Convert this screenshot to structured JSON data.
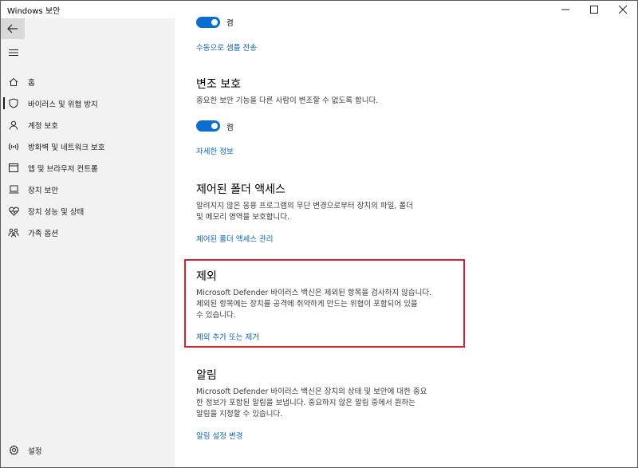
{
  "window": {
    "title": "Windows 보안",
    "minimize": "—",
    "maximize": "☐",
    "close": "✕"
  },
  "sidebar": {
    "back_icon": "back-arrow-icon",
    "menu_icon": "hamburger-icon",
    "items": [
      {
        "label": "홈",
        "icon": "home-icon"
      },
      {
        "label": "바이러스 및 위협 방지",
        "icon": "shield-icon",
        "active": true
      },
      {
        "label": "계정 보호",
        "icon": "person-icon"
      },
      {
        "label": "방화벽 및 네트워크 보호",
        "icon": "wireless-icon"
      },
      {
        "label": "앱 및 브라우저 컨트롤",
        "icon": "app-window-icon"
      },
      {
        "label": "장치 보안",
        "icon": "laptop-icon"
      },
      {
        "label": "장치 성능 및 상태",
        "icon": "heart-icon"
      },
      {
        "label": "가족 옵션",
        "icon": "family-icon"
      }
    ],
    "settings": {
      "label": "설정",
      "icon": "gear-icon"
    }
  },
  "main": {
    "top": {
      "toggle_label": "켬",
      "link": "수동으로 샘플 전송"
    },
    "tamper": {
      "title": "변조 보호",
      "desc": "중요한 보안 기능을 다른 사람이 변조할 수 없도록 합니다.",
      "toggle_label": "켬",
      "link": "자세한 정보"
    },
    "folder": {
      "title": "제어된 폴더 액세스",
      "desc_line1": "알려지지 않은 응용 프로그램의 무단 변경으로부터 장치의 파일, 폴더",
      "desc_line2": "및 메모리 영역을 보호합니다.",
      "link": "제어된 폴더 액세스 관리"
    },
    "exclusions": {
      "title": "제외",
      "desc_line1": "Microsoft Defender 바이러스 백신은 제외된 항목을 검사하지 않습니다.",
      "desc_line2": "제외된 항목에는 장치를 공격에 취약하게 만드는 위협이 포함되어 있을",
      "desc_line3": "수 있습니다.",
      "link": "제외 추가 또는 제거"
    },
    "notifications": {
      "title": "알림",
      "desc_line1": "Microsoft Defender 바이러스 백신은 장치의 상태 및 보안에 대한 중요",
      "desc_line2": "한 정보가 포함된 알림을 보냅니다. 중요하지 않은 알림 중에서 원하는",
      "desc_line3": "알림을 지정할 수 있습니다.",
      "link": "알림 설정 변경"
    }
  },
  "colors": {
    "accent": "#0a6fd1",
    "link": "#0b66b8",
    "highlight": "#d4232a",
    "sidebar_bg": "#f2f2f2"
  }
}
